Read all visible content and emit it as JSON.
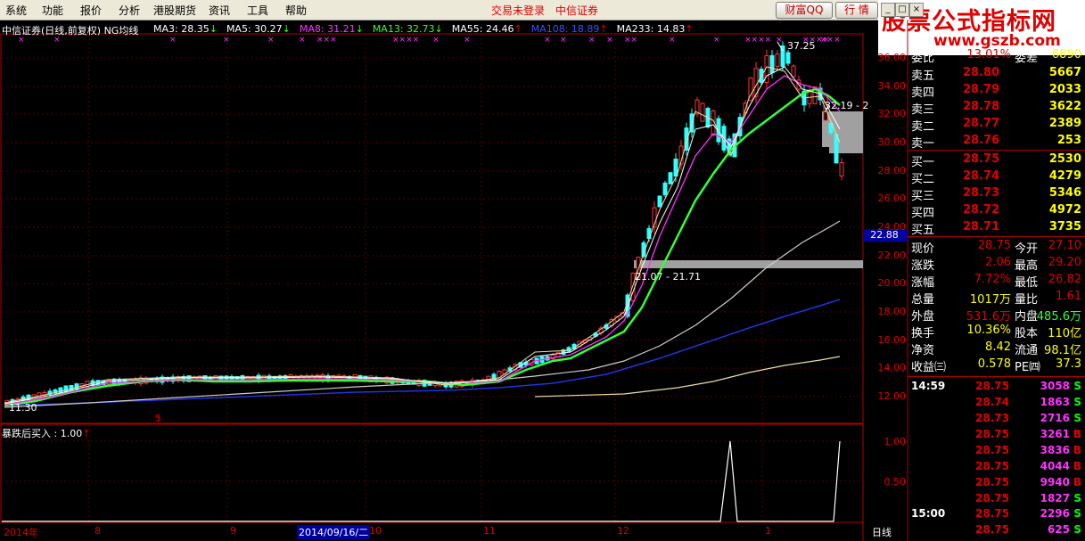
{
  "menubar": {
    "items": [
      "系统",
      "功能",
      "报价",
      "分析",
      "港股期货",
      "资讯",
      "工具",
      "帮助"
    ],
    "status": "交易未登录",
    "broker": "中信证券",
    "btn_caifu": "财富QQ",
    "btn_hangqing": "行 情"
  },
  "watermark": {
    "title": "股票公式指标网",
    "url": "www.gszb.com"
  },
  "chart": {
    "title": "中信证券(日线,前复权) NG均线",
    "ma": [
      {
        "label": "MA3: 28.35",
        "arrow": "↓",
        "color": "#ffffff"
      },
      {
        "label": "MA5: 30.27",
        "arrow": "↓",
        "color": "#ffffff"
      },
      {
        "label": "MA8: 31.21",
        "arrow": "↓",
        "color": "#ff33ff"
      },
      {
        "label": "MA13: 32.73",
        "arrow": "↓",
        "color": "#33ff33"
      },
      {
        "label": "MA55: 24.46",
        "arrow": "↑",
        "color": "#ffffff"
      },
      {
        "label": "MA108: 18.89",
        "arrow": "↑",
        "color": "#3355ff"
      },
      {
        "label": "MA233: 14.83",
        "arrow": "↑",
        "color": "#ffffff"
      }
    ],
    "price_axis": [
      "36.00",
      "34.00",
      "32.00",
      "30.00",
      "28.00",
      "26.00",
      "24.00",
      "22.00",
      "20.00",
      "18.00",
      "16.00",
      "14.00",
      "12.00"
    ],
    "current_price_tag": "22.88",
    "high_label": "37.25",
    "low_label": "11.30",
    "zone_upper_label": "32.19 - 2",
    "zone_lower_label": "21.07 - 21.71",
    "sub_title": "暴跌后买入 : 1.00",
    "sub_axis": [
      "1.00",
      "0.50"
    ],
    "date_labels": [
      "2014年",
      "8",
      "9",
      "10",
      "11",
      "12",
      "1"
    ],
    "date_selected": "2014/09/16/二",
    "period": "日线"
  },
  "quote": {
    "header": {
      "label": "委比",
      "value": "13.01%",
      "label2": "委差",
      "value2": "6890"
    },
    "asks": [
      {
        "label": "卖五",
        "price": "28.80",
        "vol": "5667"
      },
      {
        "label": "卖四",
        "price": "28.79",
        "vol": "2033"
      },
      {
        "label": "卖三",
        "price": "28.78",
        "vol": "3622"
      },
      {
        "label": "卖二",
        "price": "28.77",
        "vol": "2389"
      },
      {
        "label": "卖一",
        "price": "28.76",
        "vol": "253"
      }
    ],
    "bids": [
      {
        "label": "买一",
        "price": "28.75",
        "vol": "2530"
      },
      {
        "label": "买二",
        "price": "28.74",
        "vol": "4279"
      },
      {
        "label": "买三",
        "price": "28.73",
        "vol": "5346"
      },
      {
        "label": "买四",
        "price": "28.72",
        "vol": "4972"
      },
      {
        "label": "买五",
        "price": "28.71",
        "vol": "3735"
      }
    ],
    "stats": [
      {
        "l1": "现价",
        "v1": "28.75",
        "l2": "今开",
        "v2": "27.10",
        "c1": "#e00000",
        "c2": "#e00000"
      },
      {
        "l1": "涨跌",
        "v1": "2.06",
        "l2": "最高",
        "v2": "29.20",
        "c1": "#e00000",
        "c2": "#e00000"
      },
      {
        "l1": "涨幅",
        "v1": "7.72%",
        "l2": "最低",
        "v2": "26.82",
        "c1": "#e00000",
        "c2": "#e00000"
      },
      {
        "l1": "总量",
        "v1": "1017万",
        "l2": "量比",
        "v2": "1.61",
        "c1": "#ffff00",
        "c2": "#e00000"
      },
      {
        "l1": "外盘",
        "v1": "531.6万",
        "l2": "内盘",
        "v2": "485.6万",
        "c1": "#e00000",
        "c2": "#33ff33"
      },
      {
        "l1": "换手",
        "v1": "10.36%",
        "l2": "股本",
        "v2": "110亿",
        "c1": "#ffff00",
        "c2": "#ffff00"
      },
      {
        "l1": "净资",
        "v1": "8.42",
        "l2": "流通",
        "v2": "98.1亿",
        "c1": "#ffff00",
        "c2": "#ffff00"
      },
      {
        "l1": "收益㈢",
        "v1": "0.578",
        "l2": "PE㈣",
        "v2": "37.3",
        "c1": "#ffff00",
        "c2": "#ffff00"
      }
    ],
    "ticks": [
      {
        "time": "14:59",
        "price": "28.75",
        "vol": "3058",
        "side": "S"
      },
      {
        "time": "",
        "price": "28.74",
        "vol": "1863",
        "side": "S"
      },
      {
        "time": "",
        "price": "28.73",
        "vol": "2716",
        "side": "S"
      },
      {
        "time": "",
        "price": "28.75",
        "vol": "3261",
        "side": "B"
      },
      {
        "time": "",
        "price": "28.75",
        "vol": "3836",
        "side": "B"
      },
      {
        "time": "",
        "price": "28.75",
        "vol": "4044",
        "side": "B"
      },
      {
        "time": "",
        "price": "28.75",
        "vol": "9940",
        "side": "B"
      },
      {
        "time": "",
        "price": "28.75",
        "vol": "1827",
        "side": "S"
      },
      {
        "time": "15:00",
        "price": "28.75",
        "vol": "2296",
        "side": "S"
      },
      {
        "time": "",
        "price": "28.75",
        "vol": "625",
        "side": "S"
      }
    ]
  },
  "chart_data": {
    "type": "line",
    "ma_series": [
      {
        "name": "MA13",
        "last": 32.73
      },
      {
        "name": "MA55",
        "last": 24.46
      },
      {
        "name": "MA108",
        "last": 18.89
      },
      {
        "name": "MA233",
        "last": 14.83
      }
    ],
    "indicator": {
      "name": "暴跌后买入",
      "last": 1.0,
      "signals": 2
    }
  }
}
